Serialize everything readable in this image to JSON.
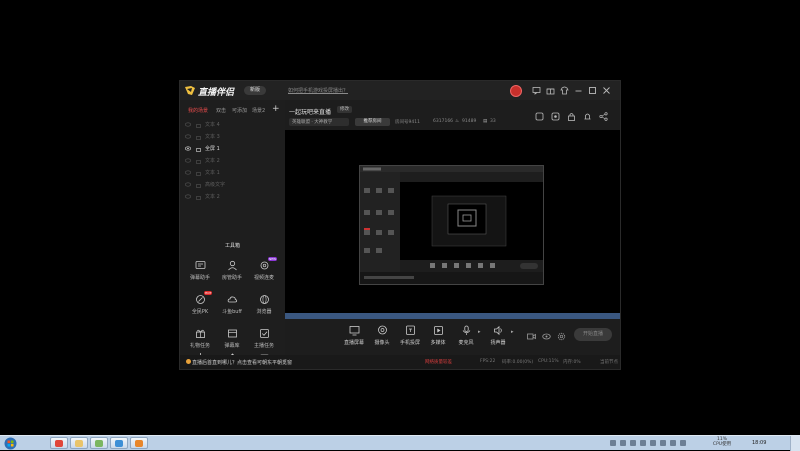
{
  "app": {
    "name": "直播伴侣",
    "version_label": "新版",
    "notice_link": "如何把手机游戏投屏播出？"
  },
  "sidebar": {
    "tabs": [
      {
        "label": "我的场景",
        "active": true
      },
      {
        "label": "双击"
      },
      {
        "label": "可添加"
      },
      {
        "label": "场景2"
      }
    ],
    "add_label": "+",
    "scenes": [
      {
        "label": "文本 4"
      },
      {
        "label": "文本 3"
      },
      {
        "label": "全屏 1",
        "active": true
      },
      {
        "label": "文本 2"
      },
      {
        "label": "文本 1"
      },
      {
        "label": "高级文字"
      },
      {
        "label": "文本 2"
      }
    ],
    "tools_title": "工具箱",
    "tools": [
      {
        "label": "弹幕助手",
        "icon": "danmu-icon"
      },
      {
        "label": "房管助手",
        "icon": "user-icon"
      },
      {
        "label": "视频连麦",
        "icon": "gear-icon",
        "badge": "NEW"
      },
      {
        "label": "全民PK",
        "icon": "pk-icon",
        "badge": "HOT"
      },
      {
        "label": "斗鱼buff",
        "icon": "cloud-icon"
      },
      {
        "label": "浏览器",
        "icon": "globe-icon"
      },
      {
        "label": "礼物任务",
        "icon": "gift-icon"
      },
      {
        "label": "弹幕库",
        "icon": "box-icon"
      },
      {
        "label": "主播任务",
        "icon": "check-icon"
      },
      {
        "label": "",
        "icon": "download-icon"
      },
      {
        "label": "",
        "icon": "upload-icon"
      },
      {
        "label": "",
        "icon": "more-icon"
      }
    ]
  },
  "room": {
    "title": "一起玩吧来直播",
    "tag": "修改",
    "category": "英雄联盟 · 大神教学",
    "share_label": "推荐房间",
    "room_id": "房间号9411",
    "fans": "6317166",
    "hot": "91489",
    "online": "33"
  },
  "bottom": {
    "controls": [
      {
        "label": "直播屏幕",
        "icon": "screen-icon"
      },
      {
        "label": "摄像头",
        "icon": "camera-icon"
      },
      {
        "label": "手机投屏",
        "icon": "phone-icon"
      },
      {
        "label": "多媒体",
        "icon": "media-icon"
      },
      {
        "label": "麦克风",
        "icon": "mic-icon"
      },
      {
        "label": "扬声器",
        "icon": "speaker-icon"
      }
    ],
    "start_live": "开始直播"
  },
  "status": {
    "message": "直播后首直到哪儿？点击查看可朝东平朝觅窗",
    "network": "网络质量较差",
    "fps": "FPS:22",
    "bitrate": "码率:0.00(0%)",
    "cpu": "CPU:11%",
    "memory": "内存:0%",
    "extra": "当前节点"
  },
  "taskbar": {
    "cpu_label": "11%",
    "cpu_sub": "CPU使用",
    "clock": "18:09"
  },
  "colors": {
    "accent_red": "#e84b4b",
    "window_bg": "#1c1c1c",
    "taskbar_bg": "#bcd0e6"
  }
}
